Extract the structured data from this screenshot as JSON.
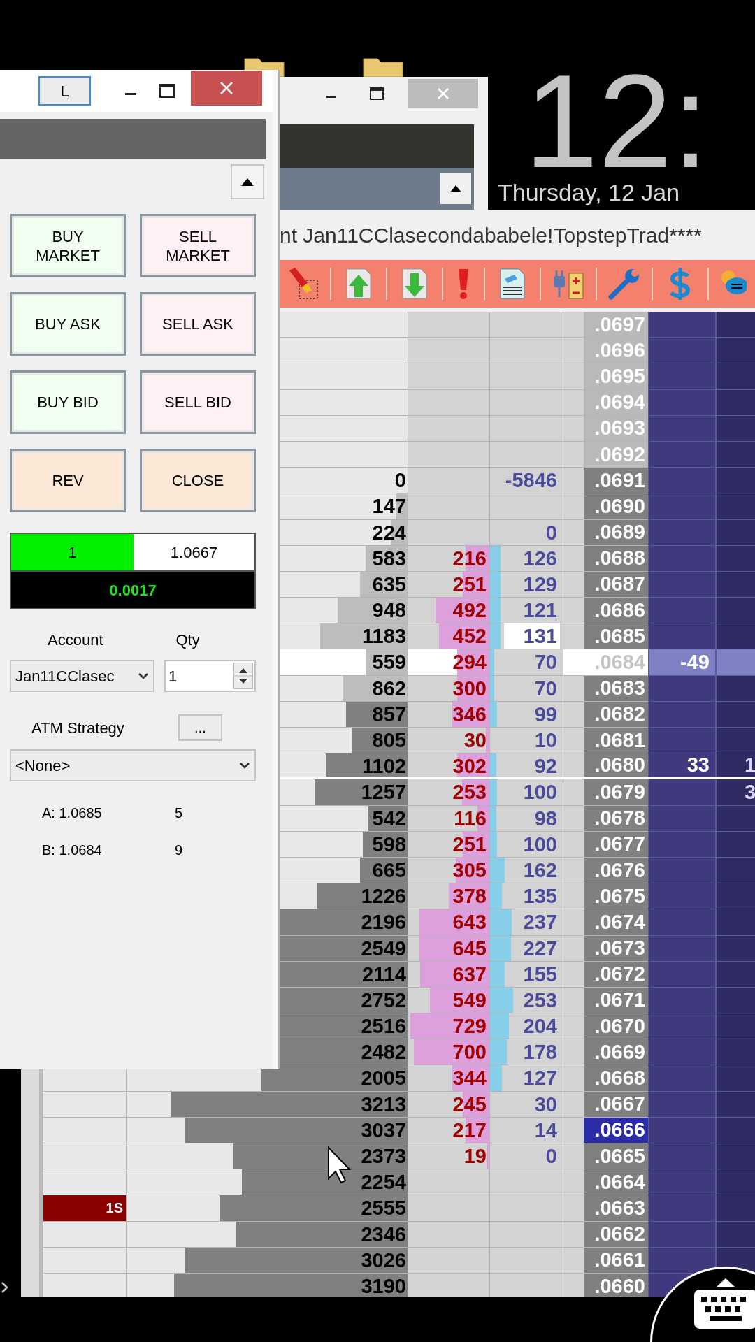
{
  "desktop": {
    "clock": "12:",
    "date": "Thursday, 12 Jan"
  },
  "order_window": {
    "title_button": "L",
    "buttons": [
      {
        "label": "BUY\nMARKET",
        "kind": "buy"
      },
      {
        "label": "SELL\nMARKET",
        "kind": "sell"
      },
      {
        "label": "BUY ASK",
        "kind": "buy"
      },
      {
        "label": "SELL ASK",
        "kind": "sell"
      },
      {
        "label": "BUY BID",
        "kind": "buy"
      },
      {
        "label": "SELL BID",
        "kind": "sell"
      },
      {
        "label": "REV",
        "kind": "neutral"
      },
      {
        "label": "CLOSE",
        "kind": "neutral"
      }
    ],
    "position": {
      "quantity": "1",
      "price": "1.0667",
      "pnl": "0.0017"
    },
    "account": {
      "label": "Account",
      "value": "Jan11CClasec"
    },
    "qty": {
      "label": "Qty",
      "value": "1"
    },
    "atm_strategy": {
      "label": "ATM Strategy",
      "button": "...",
      "value": "<None>"
    },
    "quotes": [
      {
        "label": "A: 1.0685",
        "size": "5"
      },
      {
        "label": "B: 1.0684",
        "size": "9"
      }
    ]
  },
  "dom_window": {
    "title": "nt Jan11CClasecondababele!TopstepTrad****",
    "rows": [
      {
        "kind": "blank",
        "column_5": ".0697",
        "divider_below": false
      },
      {
        "kind": "blank",
        "column_5": ".0696",
        "divider_below": false
      },
      {
        "kind": "blank",
        "column_5": ".0695",
        "divider_below": false
      },
      {
        "kind": "blank",
        "column_5": ".0694",
        "divider_below": false
      },
      {
        "kind": "blank",
        "column_5": ".0693",
        "divider_below": false
      },
      {
        "kind": "blank",
        "column_5": ".0692",
        "divider_below": false
      },
      {
        "kind": "normal",
        "column_2": {
          "text": "0",
          "level": 0
        },
        "column_4": {
          "text": "-5846",
          "level": 0,
          "highlighted": false
        },
        "column_5": ".0691",
        "divider_below": false
      },
      {
        "kind": "normal",
        "column_2": {
          "text": "147",
          "level": 0.04,
          "dark": false
        },
        "column_5": ".0690",
        "divider_below": false
      },
      {
        "kind": "normal",
        "column_2": {
          "text": "224",
          "level": 0.06,
          "dark": false
        },
        "column_4": {
          "text": "0",
          "level": 0,
          "highlighted": false
        },
        "column_5": ".0689",
        "divider_below": false
      },
      {
        "kind": "normal",
        "column_2": {
          "text": "583",
          "level": 0.15,
          "dark": false
        },
        "column_3": {
          "text": "216",
          "level": 0.29
        },
        "column_4": {
          "text": "126",
          "level": 0.14,
          "highlighted": false
        },
        "column_5": ".0688",
        "divider_below": false
      },
      {
        "kind": "normal",
        "column_2": {
          "text": "635",
          "level": 0.17,
          "dark": false
        },
        "column_3": {
          "text": "251",
          "level": 0.33
        },
        "column_4": {
          "text": "129",
          "level": 0.14,
          "highlighted": false
        },
        "column_5": ".0687",
        "divider_below": false
      },
      {
        "kind": "normal",
        "column_2": {
          "text": "948",
          "level": 0.25,
          "dark": false
        },
        "column_3": {
          "text": "492",
          "level": 0.66
        },
        "column_4": {
          "text": "121",
          "level": 0.14,
          "highlighted": false
        },
        "column_5": ".0686",
        "divider_below": false
      },
      {
        "kind": "normal",
        "column_2": {
          "text": "1183",
          "level": 0.31,
          "dark": false
        },
        "column_3": {
          "text": "452",
          "level": 0.62
        },
        "column_4": {
          "text": "131",
          "level": 0.14,
          "highlighted": true
        },
        "column_5": ".0685",
        "divider_below": false
      },
      {
        "kind": "last",
        "column_2": {
          "text": "559",
          "level": 0.15,
          "dark": false
        },
        "column_3": {
          "text": "294",
          "level": 0.4
        },
        "column_4": {
          "text": "70",
          "level": 0.06,
          "highlighted": false
        },
        "column_5": ".0684",
        "column_6": "-49",
        "divider_below": false
      },
      {
        "kind": "normal",
        "column_2": {
          "text": "862",
          "level": 0.23,
          "dark": false
        },
        "column_3": {
          "text": "300",
          "level": 0.4
        },
        "column_4": {
          "text": "70",
          "level": 0.06,
          "highlighted": false
        },
        "column_5": ".0683",
        "divider_below": false
      },
      {
        "kind": "normal",
        "column_2": {
          "text": "857",
          "level": 0.22,
          "dark": true
        },
        "column_3": {
          "text": "346",
          "level": 0.46
        },
        "column_4": {
          "text": "99",
          "level": 0.1,
          "highlighted": false
        },
        "column_5": ".0682",
        "divider_below": false
      },
      {
        "kind": "normal",
        "column_2": {
          "text": "805",
          "level": 0.2,
          "dark": true
        },
        "column_3": {
          "text": "30",
          "level": 0.04
        },
        "column_4": {
          "text": "10",
          "level": 0,
          "highlighted": false
        },
        "column_5": ".0681",
        "divider_below": false
      },
      {
        "kind": "normal",
        "column_2": {
          "text": "1102",
          "level": 0.29,
          "dark": true
        },
        "column_3": {
          "text": "302",
          "level": 0.4
        },
        "column_4": {
          "text": "92",
          "level": 0.09,
          "highlighted": false
        },
        "column_5": ".0680",
        "column_6": "33",
        "column_7": "1",
        "divider_below": true
      },
      {
        "kind": "normal",
        "column_2": {
          "text": "1257",
          "level": 0.33,
          "dark": true
        },
        "column_3": {
          "text": "253",
          "level": 0.34
        },
        "column_4": {
          "text": "100",
          "level": 0.1,
          "highlighted": false
        },
        "column_5": ".0679",
        "column_7": "3",
        "divider_below": false
      },
      {
        "kind": "normal",
        "column_2": {
          "text": "542",
          "level": 0.14,
          "dark": true
        },
        "column_3": {
          "text": "116",
          "level": 0.15
        },
        "column_4": {
          "text": "98",
          "level": 0.09,
          "highlighted": false
        },
        "column_5": ".0678",
        "divider_below": false
      },
      {
        "kind": "normal",
        "column_2": {
          "text": "598",
          "level": 0.16,
          "dark": true
        },
        "column_3": {
          "text": "251",
          "level": 0.33
        },
        "column_4": {
          "text": "100",
          "level": 0.1,
          "highlighted": false
        },
        "column_5": ".0677",
        "divider_below": false
      },
      {
        "kind": "normal",
        "column_2": {
          "text": "665",
          "level": 0.17,
          "dark": true
        },
        "column_3": {
          "text": "305",
          "level": 0.41
        },
        "column_4": {
          "text": "162",
          "level": 0.2,
          "highlighted": false
        },
        "column_5": ".0676",
        "divider_below": false
      },
      {
        "kind": "normal",
        "column_2": {
          "text": "1226",
          "level": 0.32,
          "dark": true
        },
        "column_3": {
          "text": "378",
          "level": 0.5
        },
        "column_4": {
          "text": "135",
          "level": 0.16,
          "highlighted": false
        },
        "column_5": ".0675",
        "divider_below": false
      },
      {
        "kind": "normal",
        "column_2": {
          "text": "2196",
          "level": 0.57,
          "dark": true
        },
        "column_3": {
          "text": "643",
          "level": 0.86
        },
        "column_4": {
          "text": "237",
          "level": 0.3,
          "highlighted": false
        },
        "column_5": ".0674",
        "divider_below": false
      },
      {
        "kind": "normal",
        "column_2": {
          "text": "2549",
          "level": 0.66,
          "dark": true
        },
        "column_3": {
          "text": "645",
          "level": 0.86
        },
        "column_4": {
          "text": "227",
          "level": 0.29,
          "highlighted": false
        },
        "column_5": ".0673",
        "divider_below": false
      },
      {
        "kind": "normal",
        "column_2": {
          "text": "2114",
          "level": 0.55,
          "dark": true
        },
        "column_3": {
          "text": "637",
          "level": 0.85
        },
        "column_4": {
          "text": "155",
          "level": 0.2,
          "highlighted": false
        },
        "column_5": ".0672",
        "divider_below": false
      },
      {
        "kind": "normal",
        "column_2": {
          "text": "2752",
          "level": 0.71,
          "dark": true
        },
        "column_3": {
          "text": "549",
          "level": 0.73
        },
        "column_4": {
          "text": "253",
          "level": 0.32,
          "highlighted": false
        },
        "column_5": ".0671",
        "divider_below": false
      },
      {
        "kind": "normal",
        "column_2": {
          "text": "2516",
          "level": 0.65,
          "dark": true
        },
        "column_3": {
          "text": "729",
          "level": 0.97
        },
        "column_4": {
          "text": "204",
          "level": 0.26,
          "highlighted": false
        },
        "column_5": ".0670",
        "divider_below": false
      },
      {
        "kind": "normal",
        "column_2": {
          "text": "2482",
          "level": 0.64,
          "dark": true
        },
        "column_3": {
          "text": "700",
          "level": 0.93
        },
        "column_4": {
          "text": "178",
          "level": 0.23,
          "highlighted": false
        },
        "column_5": ".0669",
        "divider_below": false
      },
      {
        "kind": "normal",
        "column_2": {
          "text": "2005",
          "level": 0.52,
          "dark": true
        },
        "column_3": {
          "text": "344",
          "level": 0.46
        },
        "column_4": {
          "text": "127",
          "level": 0.16,
          "highlighted": false
        },
        "column_5": ".0668",
        "divider_below": false
      },
      {
        "kind": "normal",
        "column_2": {
          "text": "3213",
          "level": 0.84,
          "dark": true
        },
        "column_3": {
          "text": "245",
          "level": 0.33
        },
        "column_4": {
          "text": "30",
          "level": 0,
          "highlighted": false
        },
        "column_5": ".0667",
        "divider_below": false
      },
      {
        "kind": "marked",
        "column_2": {
          "text": "3037",
          "level": 0.79,
          "dark": true
        },
        "column_3": {
          "text": "217",
          "level": 0.29
        },
        "column_4": {
          "text": "14",
          "level": 0,
          "highlighted": false
        },
        "column_5": ".0666",
        "divider_below": false
      },
      {
        "kind": "normal",
        "column_2": {
          "text": "2373",
          "level": 0.62,
          "dark": true
        },
        "column_3": {
          "text": "19",
          "level": 0.03
        },
        "column_4": {
          "text": "0",
          "level": 0,
          "highlighted": false
        },
        "column_5": ".0665",
        "divider_below": false
      },
      {
        "kind": "normal",
        "column_2": {
          "text": "2254",
          "level": 0.59,
          "dark": true
        },
        "column_5": ".0664",
        "divider_below": false
      },
      {
        "kind": "normal",
        "column_1": "1S",
        "column_2": {
          "text": "2555",
          "level": 0.67,
          "dark": true
        },
        "column_5": ".0663",
        "divider_below": false
      },
      {
        "kind": "normal",
        "column_2": {
          "text": "2346",
          "level": 0.61,
          "dark": true
        },
        "column_5": ".0662",
        "divider_below": false
      },
      {
        "kind": "normal",
        "column_2": {
          "text": "3026",
          "level": 0.79,
          "dark": true
        },
        "column_5": ".0661",
        "divider_below": false
      },
      {
        "kind": "normal",
        "column_2": {
          "text": "3190",
          "level": 0.83,
          "dark": true
        },
        "column_5": ".0660",
        "divider_below": false
      }
    ]
  }
}
